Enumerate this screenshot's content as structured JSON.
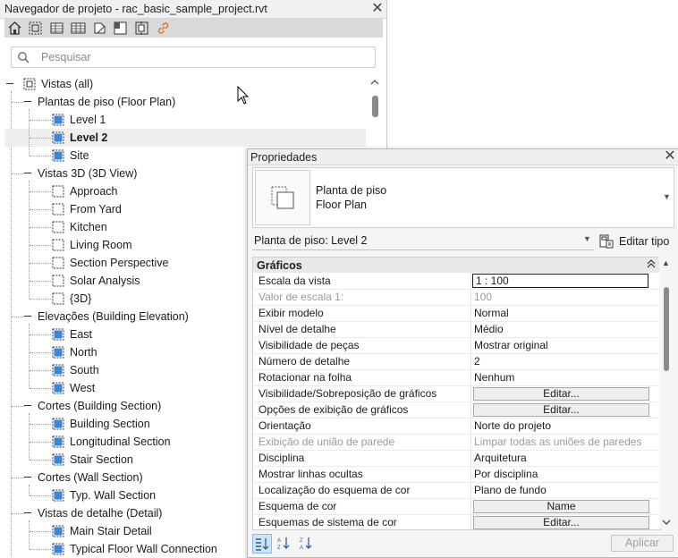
{
  "browser": {
    "title": "Navegador de projeto - rac_basic_sample_project.rvt",
    "close": "✕",
    "search_placeholder": "Pesquisar",
    "root": "Vistas (all)",
    "tree": [
      {
        "type": "group",
        "label": "Plantas de piso (Floor Plan)"
      },
      {
        "type": "view",
        "label": "Level 1"
      },
      {
        "type": "view",
        "label": "Level 2",
        "selected": true
      },
      {
        "type": "view",
        "label": "Site"
      },
      {
        "type": "group",
        "label": "Vistas 3D (3D View)"
      },
      {
        "type": "view3d",
        "label": "Approach"
      },
      {
        "type": "view3d",
        "label": "From Yard"
      },
      {
        "type": "view3d",
        "label": "Kitchen"
      },
      {
        "type": "view3d",
        "label": "Living Room"
      },
      {
        "type": "view3d",
        "label": "Section Perspective"
      },
      {
        "type": "view3d",
        "label": "Solar Analysis"
      },
      {
        "type": "view3d",
        "label": "{3D}"
      },
      {
        "type": "group",
        "label": "Elevações (Building Elevation)"
      },
      {
        "type": "view",
        "label": "East"
      },
      {
        "type": "view",
        "label": "North"
      },
      {
        "type": "view",
        "label": "South"
      },
      {
        "type": "view",
        "label": "West"
      },
      {
        "type": "group",
        "label": "Cortes (Building Section)"
      },
      {
        "type": "view",
        "label": "Building Section"
      },
      {
        "type": "view",
        "label": "Longitudinal Section"
      },
      {
        "type": "view",
        "label": "Stair Section"
      },
      {
        "type": "group",
        "label": "Cortes (Wall Section)"
      },
      {
        "type": "view",
        "label": "Typ. Wall Section"
      },
      {
        "type": "group",
        "label": "Vistas de detalhe (Detail)"
      },
      {
        "type": "view",
        "label": "Main Stair Detail"
      },
      {
        "type": "view",
        "label": "Typical Floor Wall Connection"
      }
    ]
  },
  "properties": {
    "title": "Propriedades",
    "close": "✕",
    "type_line1": "Planta de piso",
    "type_line2": "Floor Plan",
    "instance_selector": "Planta de piso: Level 2",
    "edit_type": "Editar tipo",
    "group": "Gráficos",
    "rows": [
      {
        "name": "Escala da vista",
        "value": "1 : 100",
        "kind": "box"
      },
      {
        "name": "Valor de escala    1:",
        "value": "100",
        "kind": "gray"
      },
      {
        "name": "Exibir modelo",
        "value": "Normal"
      },
      {
        "name": "Nível de detalhe",
        "value": "Médio"
      },
      {
        "name": "Visibilidade de peças",
        "value": "Mostrar original"
      },
      {
        "name": "Número de detalhe",
        "value": "2"
      },
      {
        "name": "Rotacionar na folha",
        "value": "Nenhum"
      },
      {
        "name": "Visibilidade/Sobreposição de gráficos",
        "value": "Editar...",
        "kind": "button"
      },
      {
        "name": "Opções de exibição de gráficos",
        "value": "Editar...",
        "kind": "button"
      },
      {
        "name": "Orientação",
        "value": "Norte do projeto"
      },
      {
        "name": "Exibição de união de parede",
        "value": "Limpar todas as uniões de paredes",
        "kind": "gray"
      },
      {
        "name": "Disciplina",
        "value": "Arquitetura"
      },
      {
        "name": "Mostrar linhas ocultas",
        "value": "Por disciplina"
      },
      {
        "name": "Localização do esquema de cor",
        "value": "Plano de fundo"
      },
      {
        "name": "Esquema de cor",
        "value": "Name",
        "kind": "button"
      },
      {
        "name": "Esquemas de sistema de cor",
        "value": "Editar...",
        "kind": "button"
      }
    ],
    "apply": "Aplicar"
  }
}
